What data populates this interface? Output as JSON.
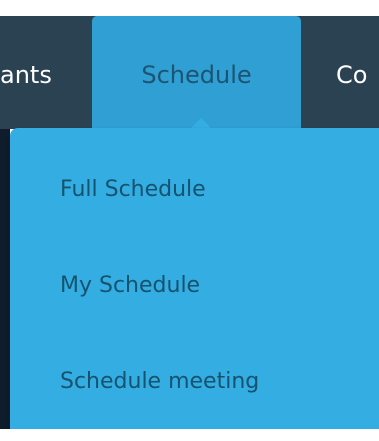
{
  "nav": {
    "items": [
      {
        "label": "ants"
      },
      {
        "label": "Schedule"
      },
      {
        "label": "Co"
      }
    ]
  },
  "dropdown": {
    "items": [
      {
        "label": "Full Schedule"
      },
      {
        "label": "My Schedule"
      },
      {
        "label": "Schedule meeting"
      }
    ]
  },
  "colors": {
    "navbar": "#2b4252",
    "active_tab": "#2f9fd4",
    "dropdown_bg": "#33ade2",
    "dropdown_text": "#15536f"
  }
}
